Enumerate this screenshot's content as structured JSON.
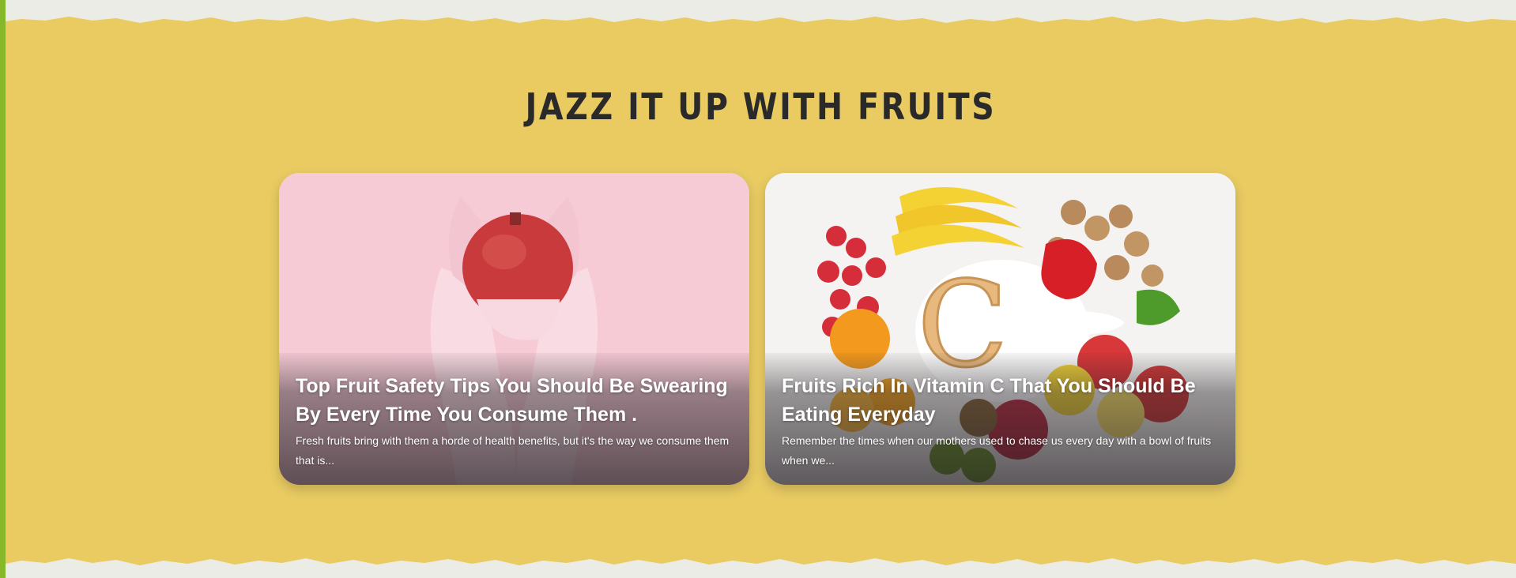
{
  "section": {
    "title": "JAZZ IT UP WITH FRUITS"
  },
  "colors": {
    "band": "#e9cb62",
    "paper": "#ecece7",
    "accent_bar": "#86b82a",
    "title": "#2a2a2a"
  },
  "cards": [
    {
      "title": "Top Fruit Safety Tips You Should Be Swearing By Every Time You Consume Them .",
      "description": "Fresh fruits bring with them a horde of health benefits, but it's the way we consume them that is...",
      "image": "pomegranate-in-gloved-hands-image"
    },
    {
      "title": "Fruits Rich In Vitamin C That You Should Be Eating Everyday",
      "description": "Remember the times when our mothers used to chase us every day with a bowl of fruits when we...",
      "image": "vitamin-c-fruits-image",
      "image_letter": "C"
    }
  ]
}
